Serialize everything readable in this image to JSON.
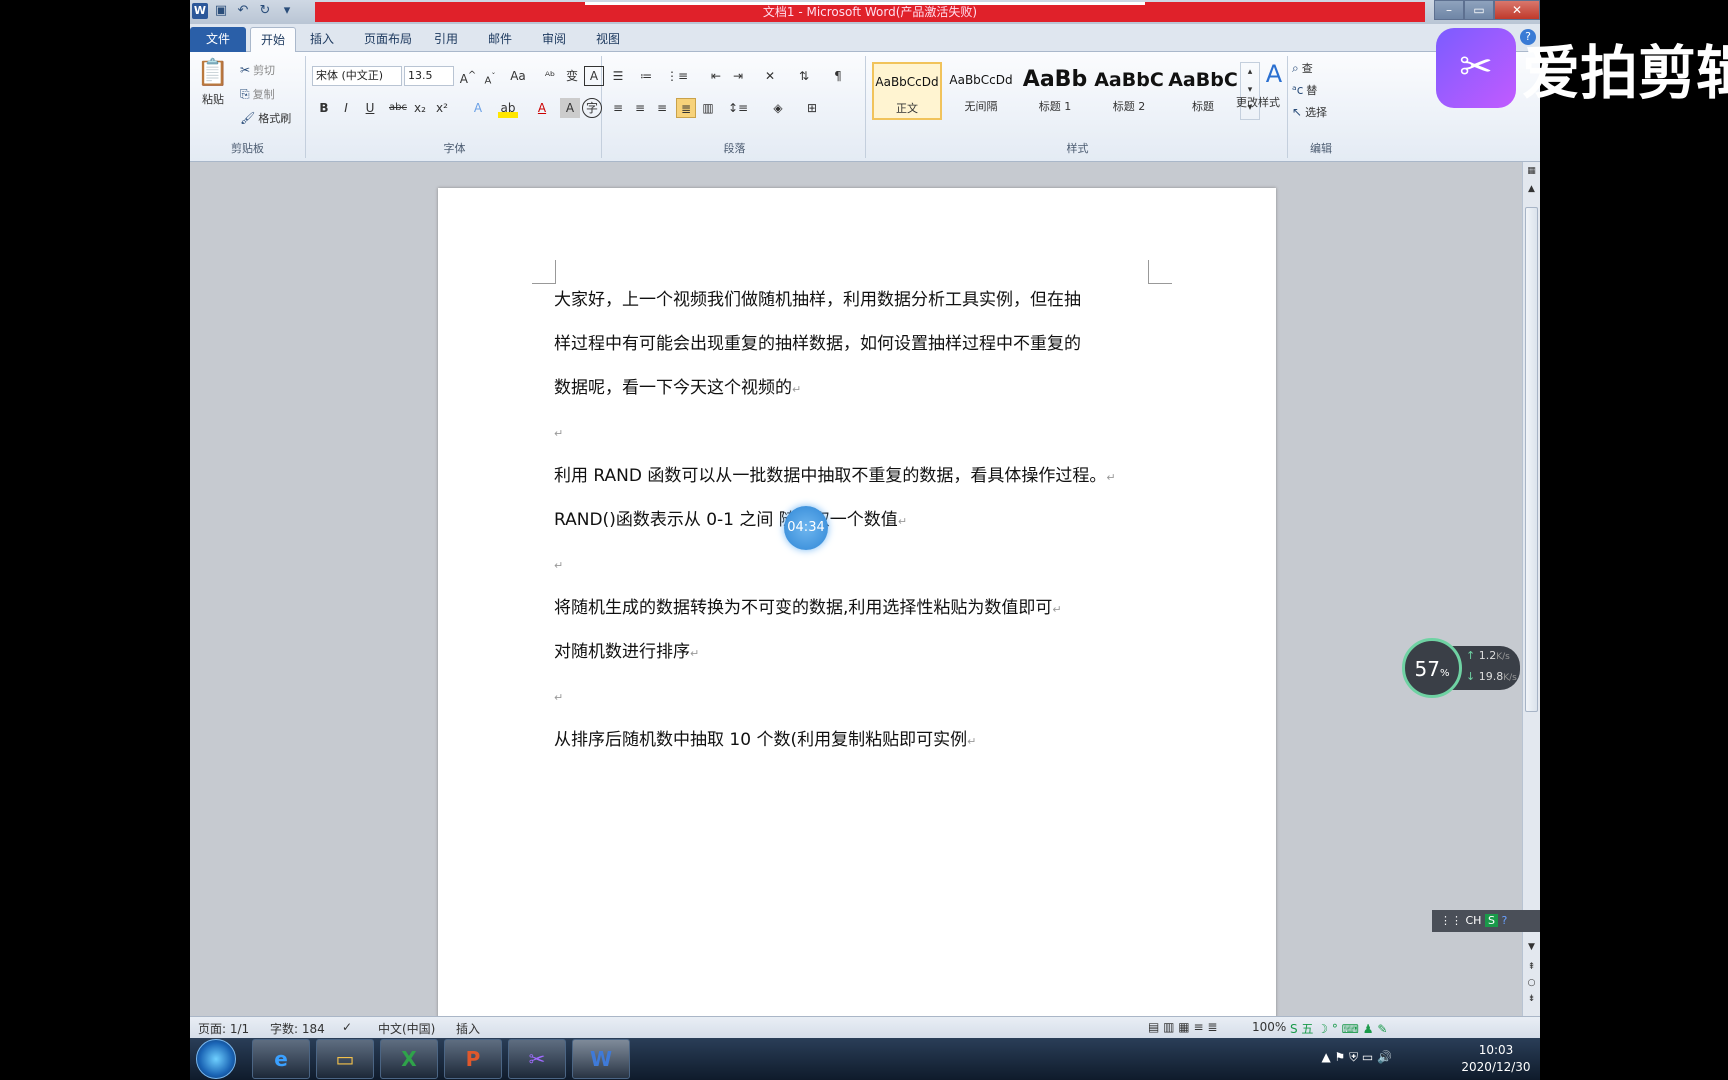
{
  "window": {
    "title": "文档1 - Microsoft Word(产品激活失败)"
  },
  "tabs": [
    {
      "label": "文件"
    },
    {
      "label": "开始"
    },
    {
      "label": "插入"
    },
    {
      "label": "页面布局"
    },
    {
      "label": "引用"
    },
    {
      "label": "邮件"
    },
    {
      "label": "审阅"
    },
    {
      "label": "视图"
    }
  ],
  "clipboard": {
    "paste": "粘贴",
    "cut": "剪切",
    "copy": "复制",
    "format_painter": "格式刷",
    "label": "剪贴板"
  },
  "font": {
    "name": "宋体 (中文正)",
    "size": "13.5",
    "label": "字体"
  },
  "paragraph": {
    "label": "段落"
  },
  "styles": {
    "items": [
      {
        "sample": "AaBbCcDd",
        "name": "正文"
      },
      {
        "sample": "AaBbCcDd",
        "name": "无间隔"
      },
      {
        "sample": "AaBb",
        "name": "标题 1"
      },
      {
        "sample": "AaBbC",
        "name": "标题 2"
      },
      {
        "sample": "AaBbC",
        "name": "标题"
      }
    ],
    "change": "更改样式",
    "label": "样式"
  },
  "editing": {
    "find": "查",
    "replace": "替",
    "select": "选择",
    "label": "编辑"
  },
  "document": {
    "paragraphs": [
      "大家好，上一个视频我们做随机抽样，利用数据分析工具实例，但在抽",
      "样过程中有可能会出现重复的抽样数据，如何设置抽样过程中不重复的",
      "数据呢，看一下今天这个视频的",
      "",
      "利用 RAND 函数可以从一批数据中抽取不重复的数据，看具体操作过程。",
      "RAND()函数表示从 0-1 之间 随机取一个数值",
      "",
      "将随机生成的数据转换为不可变的数据,利用选择性粘贴为数值即可",
      "对随机数进行排序",
      "",
      "从排序后随机数中抽取 10 个数(利用复制粘贴即可实例"
    ]
  },
  "overlay": {
    "timer": "04:34",
    "brand": "爱拍剪辑"
  },
  "network_widget": {
    "percent": "57",
    "percent_unit": "%",
    "up": "1.2",
    "down": "19.8",
    "unit": "K/s"
  },
  "ime": {
    "label": "CH"
  },
  "statusbar": {
    "page": "页面: 1/1",
    "words": "字数: 184",
    "language": "中文(中国)",
    "mode": "插入",
    "zoom": "100%"
  },
  "clock": {
    "time": "10:03",
    "date": "2020/12/30"
  }
}
